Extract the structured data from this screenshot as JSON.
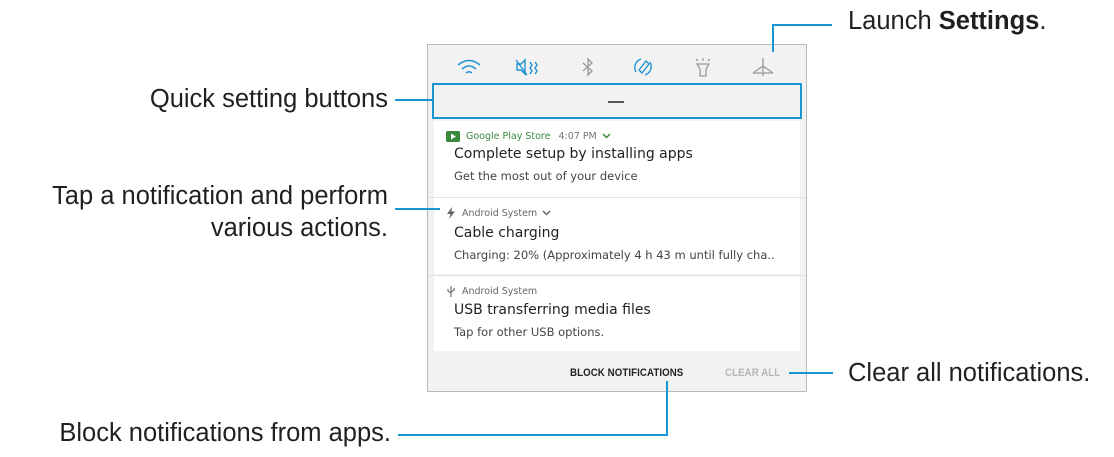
{
  "quick_settings": {
    "buttons": [
      "wifi-icon",
      "sound-vibrate-icon",
      "bluetooth-icon",
      "auto-rotate-icon",
      "flashlight-icon",
      "settings-icon"
    ],
    "accent": "#1f94d0"
  },
  "notifications": [
    {
      "app": "Google Play Store",
      "time": "4:07 PM",
      "title": "Complete setup by installing apps",
      "text": "Get the most out of your device",
      "app_color": "#3a8a3e"
    },
    {
      "app": "Android System",
      "title": "Cable charging",
      "text": "Charging: 20% (Approximately 4 h 43 m until fully cha.."
    },
    {
      "app": "Android System",
      "title": "USB transferring media files",
      "text": "Tap for other USB options."
    }
  ],
  "footer": {
    "block_label": "BLOCK NOTIFICATIONS",
    "clear_label": "CLEAR ALL"
  },
  "callouts": {
    "settings_prefix": "Launch ",
    "settings_bold": "Settings",
    "settings_suffix": ".",
    "quick_settings": "Quick setting buttons",
    "tap_line1": "Tap a notification and perform",
    "tap_line2": "various actions.",
    "clear_all": "Clear all notifications.",
    "block": "Block notifications from apps."
  },
  "colors": {
    "callout_line": "#1797cf",
    "panel_bg": "#f2f2f2",
    "card_bg": "#ffffff"
  }
}
